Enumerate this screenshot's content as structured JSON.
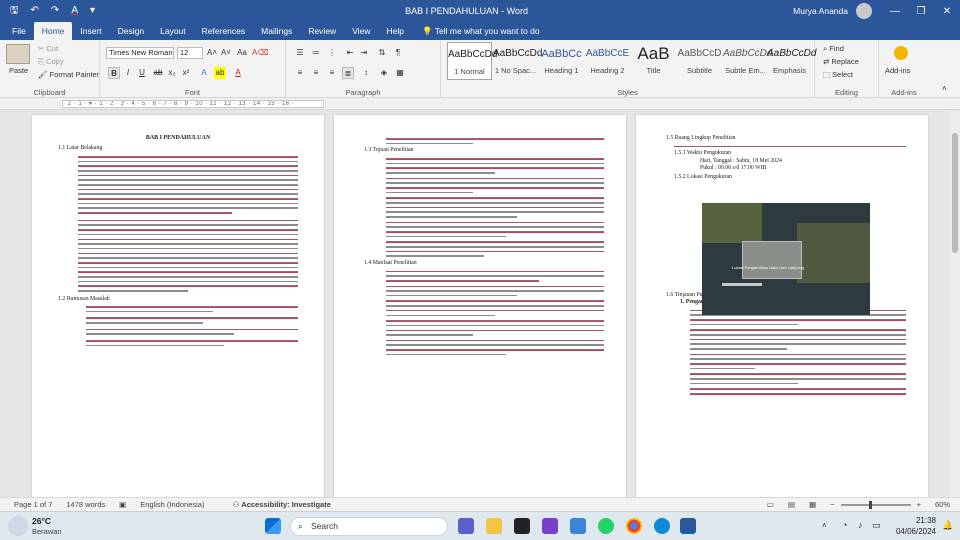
{
  "window": {
    "title": "BAB I PENDAHULUAN  -  Word",
    "user": "Murya Ananda",
    "controls": {
      "minimize": "—",
      "restore": "❐",
      "close": "✕"
    }
  },
  "tabs": [
    "File",
    "Home",
    "Insert",
    "Design",
    "Layout",
    "References",
    "Mailings",
    "Review",
    "View",
    "Help"
  ],
  "tell_me": "Tell me what you want to do",
  "ribbon": {
    "clipboard": {
      "paste": "Paste",
      "cut": "Cut",
      "copy": "Copy",
      "format_painter": "Format Painter",
      "label": "Clipboard"
    },
    "font": {
      "name": "Times New Roman",
      "size": "12",
      "label": "Font"
    },
    "paragraph": {
      "label": "Paragraph"
    },
    "styles": {
      "label": "Styles",
      "items": [
        {
          "preview": "AaBbCcDd",
          "name": "1 Normal"
        },
        {
          "preview": "AaBbCcDd",
          "name": "1 No Spac..."
        },
        {
          "preview": "AaBbCc",
          "name": "Heading 1"
        },
        {
          "preview": "AaBbCcE",
          "name": "Heading 2"
        },
        {
          "preview": "AaB",
          "name": "Title"
        },
        {
          "preview": "AaBbCcD",
          "name": "Subtitle"
        },
        {
          "preview": "AaBbCcDd",
          "name": "Subtle Em..."
        },
        {
          "preview": "AaBbCcDd",
          "name": "Emphasis"
        }
      ]
    },
    "editing": {
      "find": "Find",
      "replace": "Replace",
      "select": "Select",
      "label": "Editing"
    },
    "addins": {
      "name": "Add-ins",
      "label": "Add-ins"
    }
  },
  "ruler": {
    "scale": "· 2 · 1 · ▾ · 1 · 2 · 3 · 4 · 5 · 6 · 7 · 8 · 9 · 10 · 11 · 12 · 13 · 14 · 15 · 16 ·"
  },
  "page1": {
    "title": "BAB I PENDAHULUAN",
    "s11": "1.1 Latar Belakang",
    "s12": "1.2 Rumusan Masalah"
  },
  "page2": {
    "s13": "1.3 Tujuan Penelitian",
    "s14": "1.4 Manfaat Penelitian"
  },
  "page3": {
    "s15": "1.5 Ruang Lingkup Penelitian",
    "s151": "1.5.1    Waktu Pengukuran",
    "date": "Hari, Tanggal : Sabtu, 18 Mei 2024",
    "time": "Pukul           : 09.00 s/d 17.00 WIB",
    "s152": "1.5.2    Lokasi Pengukuran",
    "photo_caption": "Lokasi Pengambilan Data Laut Lampung",
    "s16": "1.6 Tinjauan Pustaka",
    "sub1": "1.  Pengamatan pasut menggunakan Tide Gauge dan Palem"
  },
  "status": {
    "page": "Page 1 of 7",
    "words": "1478 words",
    "language": "English (Indonesia)",
    "accessibility": "Accessibility: Investigate",
    "zoom": "60%"
  },
  "taskbar": {
    "temp": "26°C",
    "weather": "Berawan",
    "search": "Search",
    "time": "21:38",
    "date": "04/06/2024"
  }
}
